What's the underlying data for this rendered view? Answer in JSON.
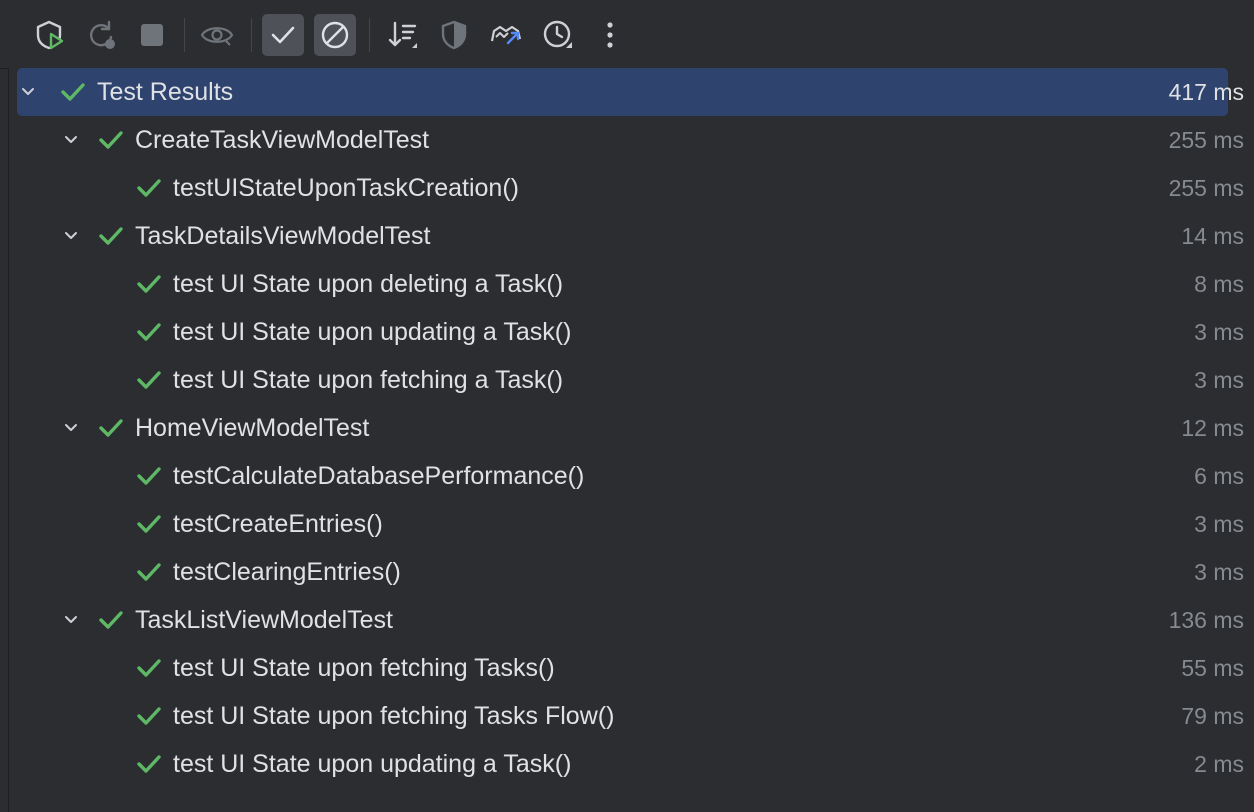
{
  "toolbar": {
    "buttons": [
      {
        "name": "rerun-tests-icon"
      },
      {
        "name": "rerun-failed-icon"
      },
      {
        "name": "stop-icon"
      },
      {
        "name": "eye-icon"
      },
      {
        "name": "show-passed-icon",
        "toggled": true
      },
      {
        "name": "show-ignored-icon",
        "toggled": true
      },
      {
        "name": "sort-icon"
      },
      {
        "name": "coverage-shield-icon"
      },
      {
        "name": "import-tests-icon"
      },
      {
        "name": "history-clock-icon"
      },
      {
        "name": "more-options-icon"
      }
    ]
  },
  "colors": {
    "pass_check": "#5fb865",
    "selection": "#2e436e",
    "background": "#2b2d30",
    "text": "#dfe1e5",
    "muted": "#868a91"
  },
  "tree": {
    "root": {
      "label": "Test Results",
      "duration": "417 ms"
    },
    "suites": [
      {
        "label": "CreateTaskViewModelTest",
        "duration": "255 ms",
        "tests": [
          {
            "label": "testUIStateUponTaskCreation()",
            "duration": "255 ms"
          }
        ]
      },
      {
        "label": "TaskDetailsViewModelTest",
        "duration": "14 ms",
        "tests": [
          {
            "label": "test UI State upon deleting a Task()",
            "duration": "8 ms"
          },
          {
            "label": "test UI State upon updating a Task()",
            "duration": "3 ms"
          },
          {
            "label": "test UI State upon fetching a Task()",
            "duration": "3 ms"
          }
        ]
      },
      {
        "label": "HomeViewModelTest",
        "duration": "12 ms",
        "tests": [
          {
            "label": "testCalculateDatabasePerformance()",
            "duration": "6 ms"
          },
          {
            "label": "testCreateEntries()",
            "duration": "3 ms"
          },
          {
            "label": "testClearingEntries()",
            "duration": "3 ms"
          }
        ]
      },
      {
        "label": "TaskListViewModelTest",
        "duration": "136 ms",
        "tests": [
          {
            "label": "test UI State upon fetching Tasks()",
            "duration": "55 ms"
          },
          {
            "label": "test UI State upon fetching Tasks Flow()",
            "duration": "79 ms"
          },
          {
            "label": "test UI State upon updating a Task()",
            "duration": "2 ms"
          }
        ]
      }
    ]
  }
}
